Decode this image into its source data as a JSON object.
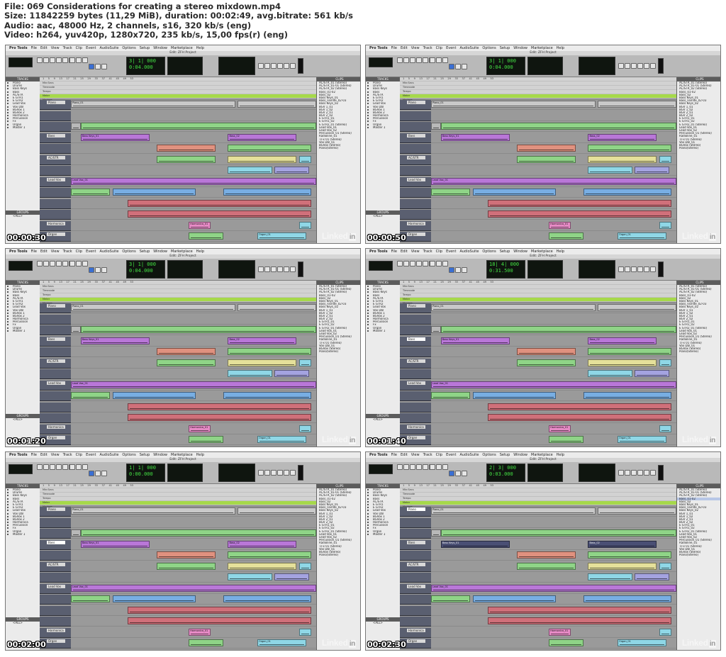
{
  "header": {
    "line1": "File: 069 Considerations for creating a stereo mixdown.mp4",
    "line2": "Size: 11842259 bytes (11,29 MiB), duration: 00:02:49, avg.bitrate: 561 kb/s",
    "line3": "Audio: aac, 48000 Hz, 2 channels, s16, 320 kb/s (eng)",
    "line4": "Video: h264, yuv420p, 1280x720, 235 kb/s, 15,00 fps(r) (eng)"
  },
  "ui": {
    "menu": [
      "Pro Tools",
      "File",
      "Edit",
      "View",
      "Track",
      "Clip",
      "Event",
      "AudioSuite",
      "Options",
      "Setup",
      "Window",
      "Marketplace",
      "Help"
    ],
    "window_title": "Edit: ZFH Project",
    "tracks_label": "TRACKS",
    "groups_label": "GROUPS",
    "clips_label": "CLIPS",
    "ruler_rows": [
      "Min:Secs",
      "Timecode",
      "Tempo",
      "Meter",
      "Markers"
    ],
    "group_item": "<ALL>",
    "tracks": [
      "Piano",
      "Drums",
      "Bass Keys",
      "Bass",
      "AC/STR",
      "E GTR1",
      "E GTR2",
      "Lead Vox",
      "Vox Dbl",
      "BGVox 1",
      "BGVox 2",
      "Harmonica",
      "Percussion",
      "Fx",
      "Organ",
      "Master 1"
    ],
    "visible_track_names": [
      "Piano",
      "Bass",
      "AC/STR",
      "E GTR1",
      "Lead Vox",
      "Vox Dbl",
      "BGVox 1",
      "Harmonica",
      "Organ"
    ],
    "clips": [
      "AC/STR_01 (Stereo)",
      "AC/STR_01-01 (Stereo)",
      "AC/STR_02 (Stereo)",
      "Bass_01-02",
      "Bass_02",
      "Bass Keys_01",
      "Bass_Fairlite_02-03",
      "Bass Keys_02",
      "BGV 1_01",
      "BGV 1_02",
      "BGV 2_01",
      "BGV 2_02",
      "E GTR1_01",
      "E GTR1_02",
      "E GTR2_01 (Stereo)",
      "Lead Vox_01",
      "Lead Vox_02",
      "Percussion_01 (Stereo)",
      "Radioline_01",
      "T.Fx 01 (Stereo)",
      "Vox Dbl_01",
      "BGVox (Stereo)",
      "Piano(Stereo)"
    ],
    "clip_labels": {
      "piano": "Piano_01",
      "bass_keys": "Bass Keys_01",
      "bass": "Bass_02",
      "lead_vox": "Lead Vox_01",
      "harmonica": "Harmonica_01",
      "organ": "Organ_01"
    },
    "logo_text": "Linked",
    "logo_in": "in"
  },
  "frames": [
    {
      "timestamp": "00:00:30",
      "counter": "3| 1| 000",
      "sub_counter": "0:04.000",
      "selected_track": -1
    },
    {
      "timestamp": "00:00:50",
      "counter": "3| 1| 000",
      "sub_counter": "0:04.000",
      "selected_track": -1
    },
    {
      "timestamp": "00:01:20",
      "counter": "3| 1| 000",
      "sub_counter": "0:04.000",
      "selected_track": -1
    },
    {
      "timestamp": "00:01:40",
      "counter": "18| 4| 000",
      "sub_counter": "0:31.500",
      "selected_track": 1
    },
    {
      "timestamp": "00:02:00",
      "counter": "1| 1| 000",
      "sub_counter": "0:00.000",
      "selected_track": 1
    },
    {
      "timestamp": "00:02:30",
      "counter": "2| 3| 000",
      "sub_counter": "0:03.000",
      "selected_track": 0
    }
  ]
}
